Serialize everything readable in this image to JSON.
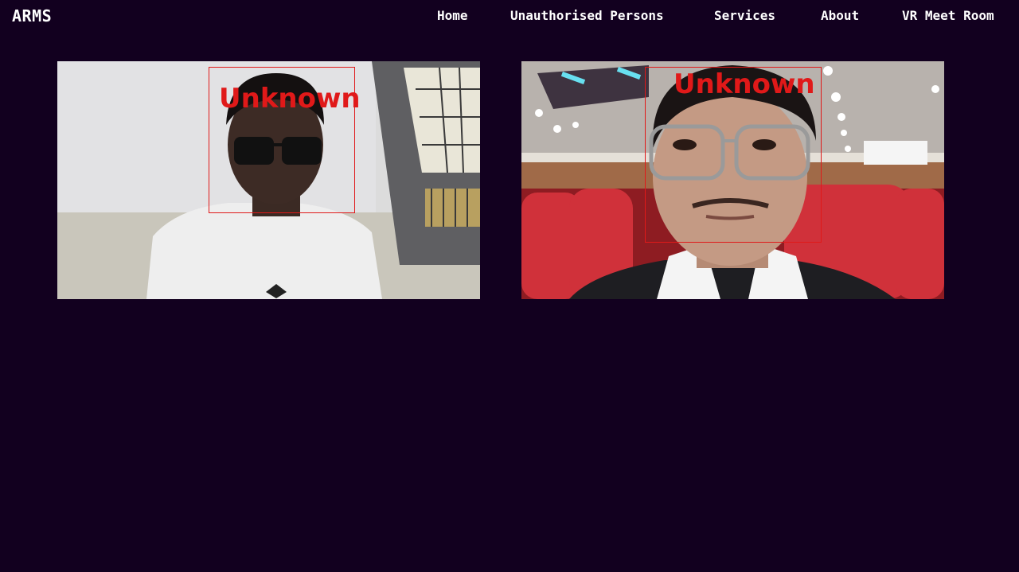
{
  "app": {
    "brand": "ARMS"
  },
  "nav": {
    "home": "Home",
    "unauthorised": "Unauthorised Persons",
    "services": "Services",
    "about": "About",
    "vr_meet": "VR Meet Room"
  },
  "feeds": [
    {
      "detection_label": "Unknown"
    },
    {
      "detection_label": "Unknown"
    }
  ],
  "colors": {
    "background": "#12001f",
    "nav_text": "#ffffff",
    "detection": "#e01919"
  }
}
